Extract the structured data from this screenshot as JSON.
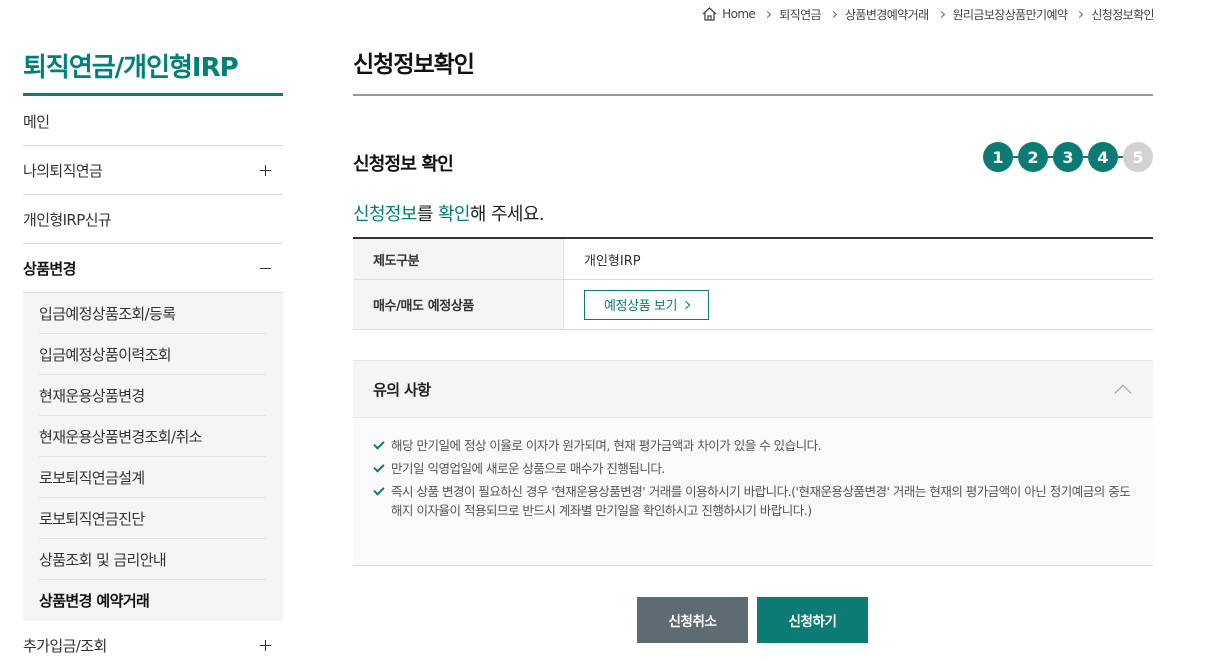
{
  "breadcrumb": [
    "Home",
    "퇴직연금",
    "상품변경예약거래",
    "원리금보장상품만기예약",
    "신청정보확인"
  ],
  "sidebar": {
    "title": "퇴직연금/개인형IRP",
    "items": [
      {
        "label": "메인"
      },
      {
        "label": "나의퇴직연금"
      },
      {
        "label": "개인형IRP신규"
      },
      {
        "label": "상품변경"
      },
      {
        "label": "추가입금/조회"
      }
    ],
    "submenu": [
      "입금예정상품조회/등록",
      "입금예정상품이력조회",
      "현재운용상품변경",
      "현재운용상품변경조회/취소",
      "로보퇴직연금설계",
      "로보퇴직연금진단",
      "상품조회 및 금리안내",
      "상품변경 예약거래"
    ]
  },
  "main": {
    "page_title": "신청정보확인",
    "section_title": "신청정보 확인",
    "steps": [
      "1",
      "2",
      "3",
      "4",
      "5"
    ],
    "current_step": 4,
    "lead_hl1": "신청정보",
    "lead_mid": "를 ",
    "lead_hl2": "확인",
    "lead_rest": "해 주세요.",
    "table": {
      "row1_label": "제도구분",
      "row1_value": "개인형IRP",
      "row2_label": "매수/매도 예정상품",
      "row2_button": "예정상품 보기"
    },
    "notice": {
      "title": "유의 사항",
      "items": [
        "해당 만기일에 정상 이율로 이자가 원가되며, 현재 평가금액과 차이가 있을 수 있습니다.",
        "만기일 익영업일에 새로운 상품으로 매수가 진행됩니다.",
        "즉시 상품 변경이 필요하신 경우 '현재운용상품변경' 거래를 이용하시기 바랍니다.('현재운용상품변경' 거래는 현재의 평가금액이 아닌 정기예금의 중도해지 이자율이 적용되므로 반드시 계좌별 만기일을 확인하시고 진행하시기 바랍니다.)"
      ]
    },
    "buttons": {
      "cancel": "신청취소",
      "submit": "신청하기"
    }
  },
  "colors": {
    "brand": "#0b7b74",
    "cancel": "#5f6b73",
    "step_inactive": "#d2d2d2"
  }
}
